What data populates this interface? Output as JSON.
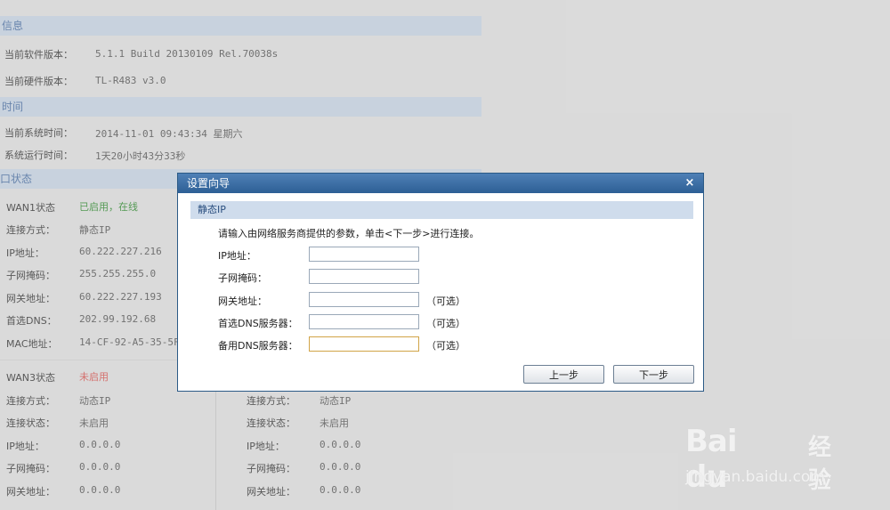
{
  "info": {
    "section_title": "信息",
    "software_label": "当前软件版本：",
    "software_value": "5.1.1 Build 20130109 Rel.70038s",
    "hardware_label": "当前硬件版本：",
    "hardware_value": "TL-R483 v3.0"
  },
  "time": {
    "section_title": "时间",
    "system_time_label": "当前系统时间：",
    "system_time_value": "2014-11-01 09:43:34 星期六",
    "uptime_label": "系统运行时间：",
    "uptime_value": "1天20小时43分33秒"
  },
  "port_status": {
    "section_title": "口状态",
    "wan1": {
      "status_label": "WAN1状态",
      "status_value": "已启用，在线",
      "conn_type_label": "连接方式：",
      "conn_type_value": "静态IP",
      "ip_label": "IP地址：",
      "ip_value": "60.222.227.216",
      "mask_label": "子网掩码：",
      "mask_value": "255.255.255.0",
      "gateway_label": "网关地址：",
      "gateway_value": "60.222.227.193",
      "dns_label": "首选DNS：",
      "dns_value": "202.99.192.68",
      "mac_label": "MAC地址：",
      "mac_value": "14-CF-92-A5-35-5F"
    },
    "wan3": {
      "status_label": "WAN3状态",
      "status_value": "未启用",
      "conn_type_label": "连接方式：",
      "conn_type_value": "动态IP",
      "conn_state_label": "连接状态：",
      "conn_state_value": "未启用",
      "ip_label": "IP地址：",
      "ip_value": "0.0.0.0",
      "mask_label": "子网掩码：",
      "mask_value": "0.0.0.0",
      "gateway_label": "网关地址：",
      "gateway_value": "0.0.0.0"
    },
    "right": {
      "conn_type_label": "连接方式：",
      "conn_type_value": "动态IP",
      "conn_state_label": "连接状态：",
      "conn_state_value": "未启用",
      "ip_label": "IP地址：",
      "ip_value": "0.0.0.0",
      "mask_label": "子网掩码：",
      "mask_value": "0.0.0.0",
      "gateway_label": "网关地址：",
      "gateway_value": "0.0.0.0"
    }
  },
  "dialog": {
    "title": "设置向导",
    "close_glyph": "×",
    "subtitle": "静态IP",
    "instruction": "请输入由网络服务商提供的参数，单击<下一步>进行连接。",
    "fields": {
      "ip_label": "IP地址：",
      "ip_value": "",
      "mask_label": "子网掩码：",
      "mask_value": "",
      "gateway_label": "网关地址：",
      "gateway_value": "",
      "gateway_optional": "（可选）",
      "dns1_label": "首选DNS服务器：",
      "dns1_value": "",
      "dns1_optional": "（可选）",
      "dns2_label": "备用DNS服务器：",
      "dns2_value": "",
      "dns2_optional": "（可选）"
    },
    "prev_button": "上一步",
    "next_button": "下一步"
  },
  "watermark": {
    "brand": "Bai du",
    "brand_cn": "经验",
    "url": "jingyan.baidu.com"
  },
  "colors": {
    "section_bar": "#c8d6e6",
    "dialog_title": "#2d5f95",
    "status_on": "#2e8b2e",
    "status_off": "#d9534f"
  }
}
